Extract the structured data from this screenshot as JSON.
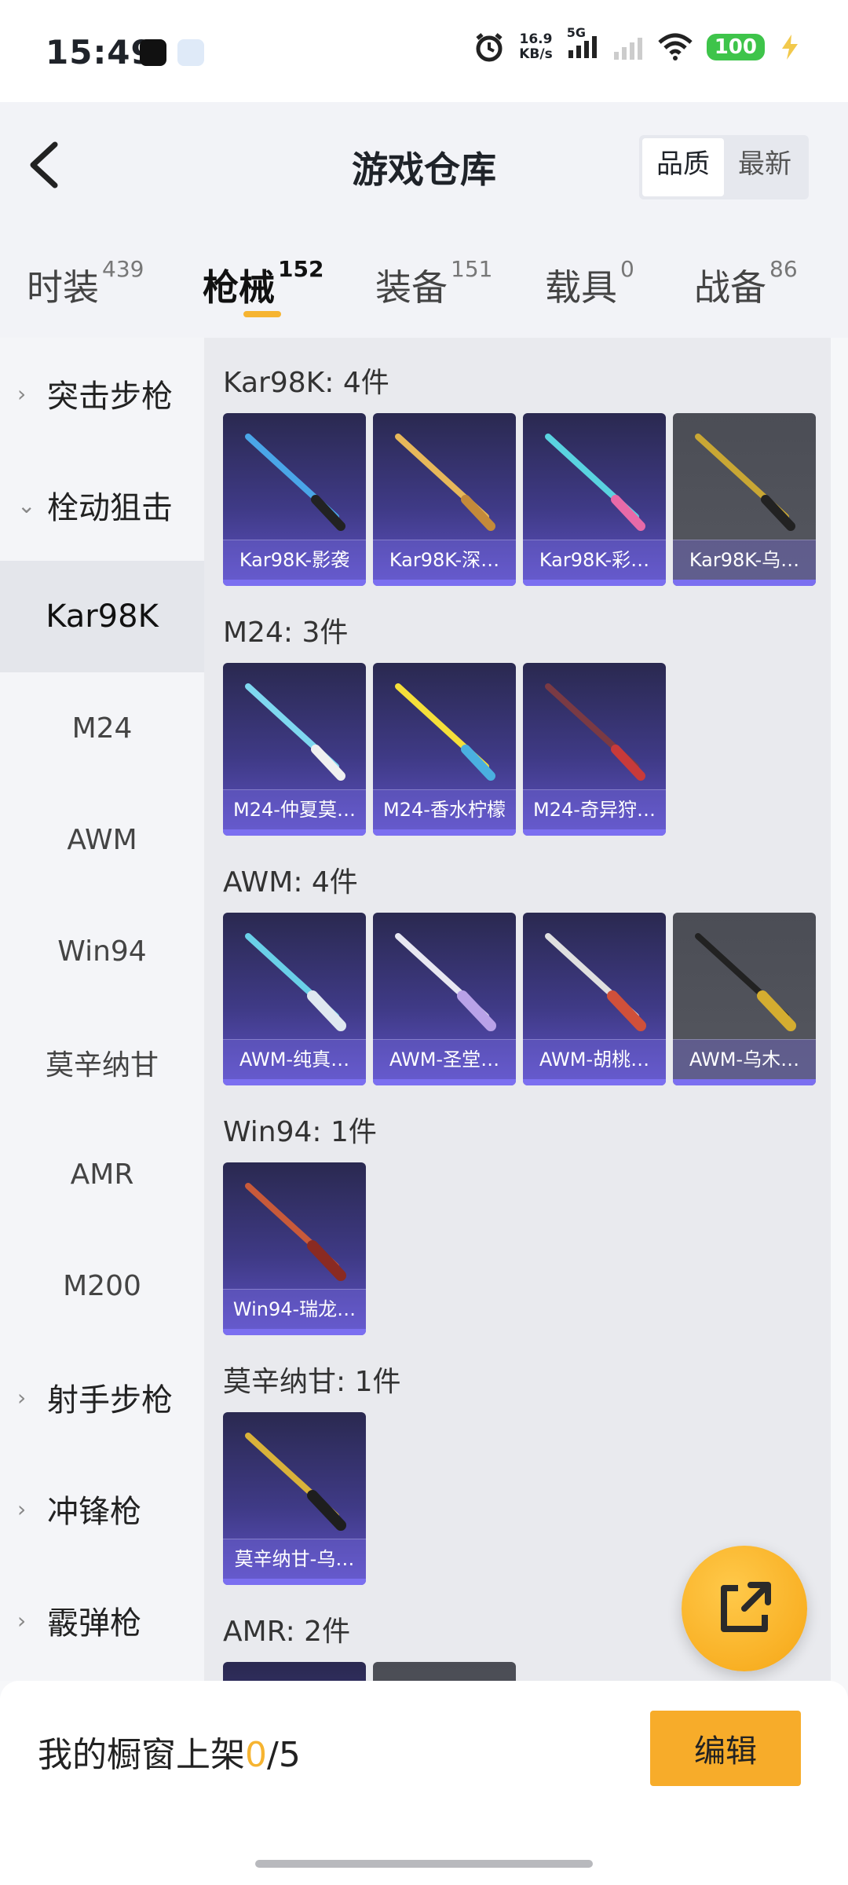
{
  "status": {
    "time": "15:49",
    "net_speed_value": "16.9",
    "net_speed_unit": "KB/s",
    "network_type": "5G",
    "battery": "100"
  },
  "header": {
    "title": "游戏仓库",
    "sort_options": [
      "品质",
      "最新"
    ],
    "active_sort": "品质"
  },
  "tabs": [
    {
      "label": "时装",
      "count": "439"
    },
    {
      "label": "枪械",
      "count": "152"
    },
    {
      "label": "装备",
      "count": "151"
    },
    {
      "label": "载具",
      "count": "0"
    },
    {
      "label": "战备",
      "count": "86"
    }
  ],
  "active_tab": "枪械",
  "sidebar": {
    "groups": {
      "assault": "突击步枪",
      "bolt": "栓动狙击",
      "marksman": "射手步枪",
      "smg": "冲锋枪",
      "shotgun": "霰弹枪"
    },
    "subitems": [
      "Kar98K",
      "M24",
      "AWM",
      "Win94",
      "莫辛纳甘",
      "AMR",
      "M200"
    ],
    "active_subitem": "Kar98K"
  },
  "sections": [
    {
      "title": "Kar98K: 4件",
      "items": [
        "Kar98K-影袭",
        "Kar98K-深…",
        "Kar98K-彩…",
        "Kar98K-乌…"
      ]
    },
    {
      "title": "M24: 3件",
      "items": [
        "M24-仲夏莫…",
        "M24-香水柠檬",
        "M24-奇异狩…"
      ]
    },
    {
      "title": "AWM: 4件",
      "items": [
        "AWM-纯真…",
        "AWM-圣堂…",
        "AWM-胡桃…",
        "AWM-乌木…"
      ]
    },
    {
      "title": "Win94: 1件",
      "items": [
        "Win94-瑞龙…"
      ]
    },
    {
      "title": "莫辛纳甘: 1件",
      "items": [
        "莫辛纳甘-乌…"
      ]
    },
    {
      "title": "AMR: 2件",
      "items": []
    }
  ],
  "bottom": {
    "showcase_prefix": "我的橱窗上架",
    "showcase_count": "0",
    "showcase_total": "/5",
    "edit_label": "编辑"
  },
  "colors": {
    "accent": "#f6b431",
    "card_purple": "#3f3a86",
    "card_grey": "#55575f"
  }
}
